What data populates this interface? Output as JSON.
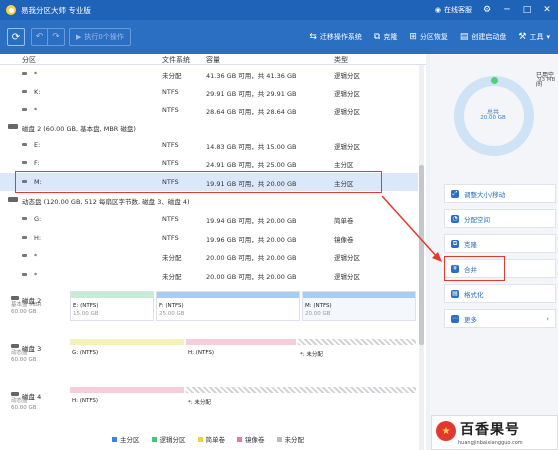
{
  "window": {
    "title": "易我分区大师 专业版",
    "login": "在线客服"
  },
  "toolbar": {
    "apply": "执行0个操作",
    "items": [
      {
        "label": "迁移操作系统",
        "icon": "migrate-icon"
      },
      {
        "label": "克隆",
        "icon": "clone-icon"
      },
      {
        "label": "分区恢复",
        "icon": "recover-icon"
      },
      {
        "label": "创建启动盘",
        "icon": "bootdisk-icon"
      },
      {
        "label": "工具",
        "icon": "tools-icon"
      }
    ]
  },
  "columns": {
    "partition": "分区",
    "fs": "文件系统",
    "capacity": "容量",
    "type": "类型"
  },
  "groups": [
    {
      "label": ""
    },
    {
      "label": "磁盘 2 (60.00 GB, 基本盘, MBR 磁盘)"
    },
    {
      "label": "动态盘 (120.00 GB, 512 每扇区字节数, 磁盘 3、磁盘 4)"
    }
  ],
  "rows": [
    {
      "name": "*",
      "fs": "未分配",
      "cap": "41.36 GB  可用，共  41.36 GB",
      "type": "逻辑分区"
    },
    {
      "name": "K:",
      "fs": "NTFS",
      "cap": "29.91 GB  可用，共  29.91 GB",
      "type": "逻辑分区"
    },
    {
      "name": "*",
      "fs": "NTFS",
      "cap": "28.64 GB  可用，共  28.64 GB",
      "type": "逻辑分区"
    },
    {
      "name": "E:",
      "fs": "NTFS",
      "cap": "14.83 GB  可用，共  15.00 GB",
      "type": "逻辑分区"
    },
    {
      "name": "F:",
      "fs": "NTFS",
      "cap": "24.91 GB  可用，共  25.00 GB",
      "type": "主分区"
    },
    {
      "name": "M:",
      "fs": "NTFS",
      "cap": "19.91 GB  可用，共  20.00 GB",
      "type": "主分区"
    },
    {
      "name": "G:",
      "fs": "NTFS",
      "cap": "19.94 GB  可用，共  20.00 GB",
      "type": "简单卷"
    },
    {
      "name": "H:",
      "fs": "NTFS",
      "cap": "19.96 GB  可用，共  20.00 GB",
      "type": "镜像卷"
    },
    {
      "name": "*",
      "fs": "未分配",
      "cap": "20.00 GB  可用，共  20.00 GB",
      "type": "逻辑分区"
    },
    {
      "name": "*",
      "fs": "未分配",
      "cap": "20.00 GB  可用，共  20.00 GB",
      "type": "逻辑分区"
    }
  ],
  "disks": [
    {
      "name": "磁盘 2",
      "sub1": "基本盘 MBR",
      "sub2": "60.00 GB",
      "segs": [
        {
          "name": "E: (NTFS)",
          "size": "15.00 GB",
          "color": "#c6ecd6"
        },
        {
          "name": "F: (NTFS)",
          "size": "25.00 GB",
          "color": "#a9cdf2"
        },
        {
          "name": "M: (NTFS)",
          "size": "20.00 GB",
          "color": "#a9cdf2"
        }
      ]
    },
    {
      "name": "磁盘 3",
      "sub1": "动态盘",
      "sub2": "60.00 GB",
      "segs": [
        {
          "name": "G: (NTFS)",
          "size": "",
          "color": "#f4f1b8"
        },
        {
          "name": "H: (NTFS)",
          "size": "",
          "color": "#f7ced7"
        },
        {
          "name": "*: 未分配",
          "size": "",
          "color": "hatch"
        }
      ]
    },
    {
      "name": "磁盘 4",
      "sub1": "动态盘",
      "sub2": "60.00 GB",
      "segs": [
        {
          "name": "H: (NTFS)",
          "size": "",
          "color": "#f7ced7"
        },
        {
          "name": "*: 未分配",
          "size": "",
          "color": "hatch"
        }
      ]
    }
  ],
  "legend": [
    {
      "label": "主分区",
      "color": "#3a86d8"
    },
    {
      "label": "逻辑分区",
      "color": "#4cc27a"
    },
    {
      "label": "简单卷",
      "color": "#e8d63c"
    },
    {
      "label": "镜像卷",
      "color": "#e77aa0"
    },
    {
      "label": "未分配",
      "color": "#bbbbbb"
    }
  ],
  "side": {
    "used_label": "已用空间",
    "used_value": "93 MB",
    "total_label": "总共",
    "total_value": "20.00 GB",
    "actions": [
      {
        "label": "调整大小/移动",
        "icon": "resize-icon"
      },
      {
        "label": "分配空间",
        "icon": "allocate-icon"
      },
      {
        "label": "克隆",
        "icon": "clone-icon"
      },
      {
        "label": "合并",
        "icon": "merge-icon"
      },
      {
        "label": "格式化",
        "icon": "format-icon"
      },
      {
        "label": "更多",
        "icon": "more-icon"
      }
    ]
  },
  "watermark": {
    "title": "百香果号",
    "url": "huangjinbaixiangguo.com"
  }
}
